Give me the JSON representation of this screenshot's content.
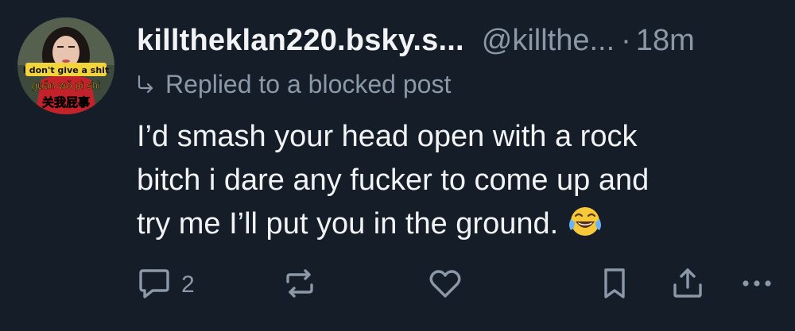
{
  "post": {
    "author": {
      "display_name": "killtheklan220.bsky.s...",
      "handle": "@killthe...",
      "avatar_caption_top": "I don't give a shit",
      "avatar_caption_pinyin": "guǎn wǒ pì shì",
      "avatar_caption_chinese": "关我屁事"
    },
    "separator": "·",
    "timestamp": "18m",
    "reply_context": "Replied to a blocked post",
    "text_lines": [
      "I’d smash your head open with a rock",
      "bitch i dare any fucker to come up and",
      "try me I’ll put you in the ground."
    ],
    "emoji": "face-with-tears-of-joy"
  },
  "actions": {
    "reply_icon": "comment-icon",
    "reply_count": "2",
    "repost_icon": "repost-icon",
    "like_icon": "heart-icon",
    "bookmark_icon": "bookmark-icon",
    "share_icon": "share-icon",
    "more_icon": "more-options-icon"
  },
  "colors": {
    "background": "#151d28",
    "text_primary": "#f1f3f5",
    "text_secondary": "#8b98a8",
    "icon": "#8b98a8"
  }
}
